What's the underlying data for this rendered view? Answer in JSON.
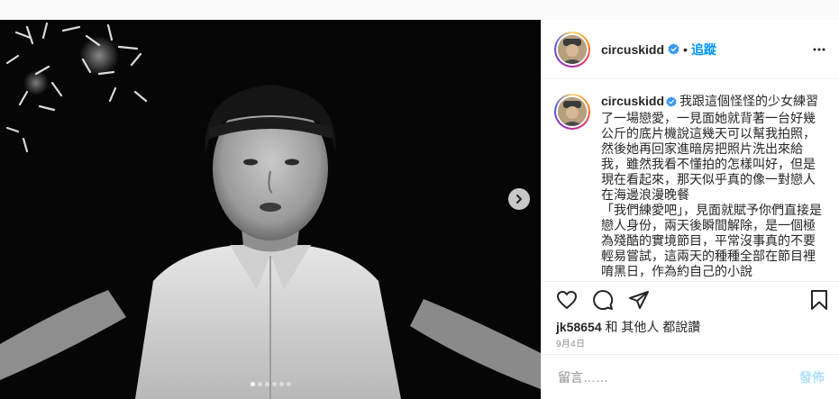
{
  "post": {
    "username": "circuskidd",
    "bullet": "•",
    "follow_label": "追蹤",
    "caption_username": "circuskidd",
    "caption": "我跟這個怪怪的少女練習了一場戀愛，一見面她就背著一台好幾公斤的底片機說這幾天可以幫我拍照，然後她再回家進暗房把照片洗出來給我，雖然我看不懂拍的怎樣叫好，但是現在看起來，那天似乎真的像一對戀人在海邊浪漫晚餐\n「我們練愛吧」，見面就賦予你們直接是戀人身份，兩天後瞬間解除，是一個極為殘酷的實境節目，平常沒事真的不要輕易嘗試，這兩天的種種全部在節目裡唷黑日，作為約自己的小說",
    "likes_user": "jk58654",
    "likes_rest": " 和 其他人 都說讚",
    "date": "9月4日",
    "comment_placeholder": "留言……",
    "post_label": "發佈"
  },
  "carousel": {
    "total": 6,
    "active": 0
  },
  "icons": {
    "verified": "verified-badge-icon",
    "more": "more-options-icon",
    "like": "heart-icon",
    "comment": "comment-bubble-icon",
    "share": "paper-plane-icon",
    "save": "bookmark-icon",
    "next": "chevron-right-icon"
  },
  "colors": {
    "link_blue": "#0095f6",
    "post_disabled": "#b2dffc",
    "muted": "#8e8e8e"
  }
}
